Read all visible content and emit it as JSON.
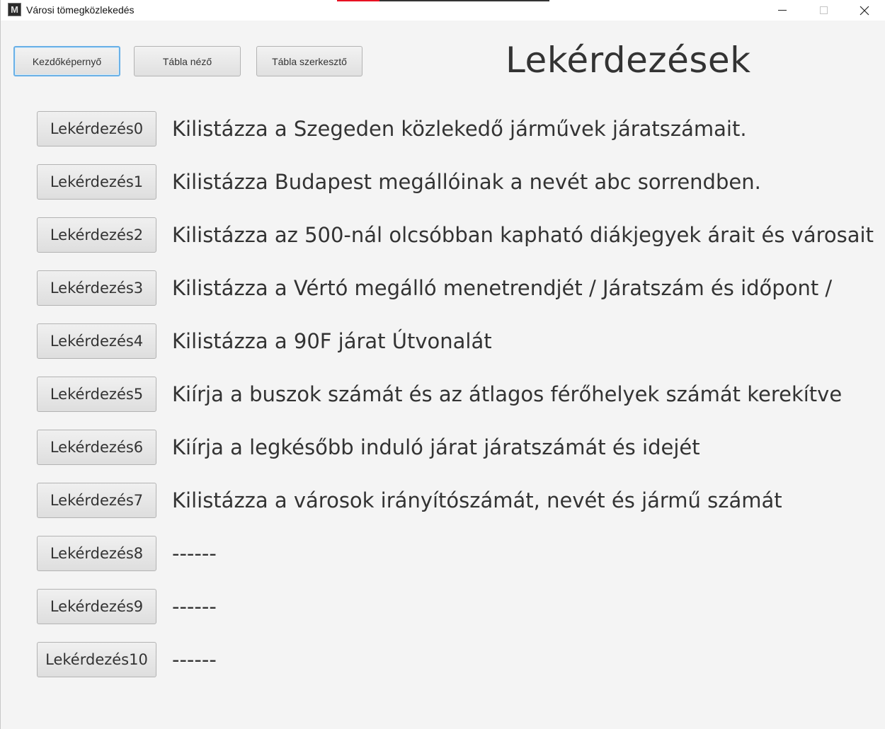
{
  "window": {
    "title": "Városi tömegközlekedés",
    "app_icon_letter": "M",
    "controls": {
      "minimize": "minimize-icon",
      "maximize": "maximize-icon",
      "close": "close-icon"
    }
  },
  "nav": {
    "home_label": "Kezdőképernyő",
    "table_view_label": "Tábla néző",
    "table_edit_label": "Tábla szerkesztő"
  },
  "page": {
    "title": "Lekérdezések"
  },
  "queries": [
    {
      "button": "Lekérdezés0",
      "description": "Kilistázza a Szegeden közlekedő járművek járatszámait."
    },
    {
      "button": "Lekérdezés1",
      "description": "Kilistázza Budapest megállóinak a nevét abc sorrendben."
    },
    {
      "button": "Lekérdezés2",
      "description": "Kilistázza az 500-nál olcsóbban kapható diákjegyek árait és városait"
    },
    {
      "button": "Lekérdezés3",
      "description": "Kilistázza a Vértó megálló menetrendjét / Járatszám és időpont /"
    },
    {
      "button": "Lekérdezés4",
      "description": "Kilistázza a 90F járat Útvonalát"
    },
    {
      "button": "Lekérdezés5",
      "description": "Kiírja a buszok számát és az átlagos férőhelyek számát kerekítve"
    },
    {
      "button": "Lekérdezés6",
      "description": "Kiírja a legkésőbb induló járat járatszámát és idejét"
    },
    {
      "button": "Lekérdezés7",
      "description": "Kilistázza a városok irányítószámát, nevét és jármű számát"
    },
    {
      "button": "Lekérdezés8",
      "description": "------"
    },
    {
      "button": "Lekérdezés9",
      "description": "------"
    },
    {
      "button": "Lekérdezés10",
      "description": "------"
    }
  ],
  "colors": {
    "focus_ring": "#6ab0e6",
    "background": "#f4f4f4",
    "text": "#333333"
  }
}
